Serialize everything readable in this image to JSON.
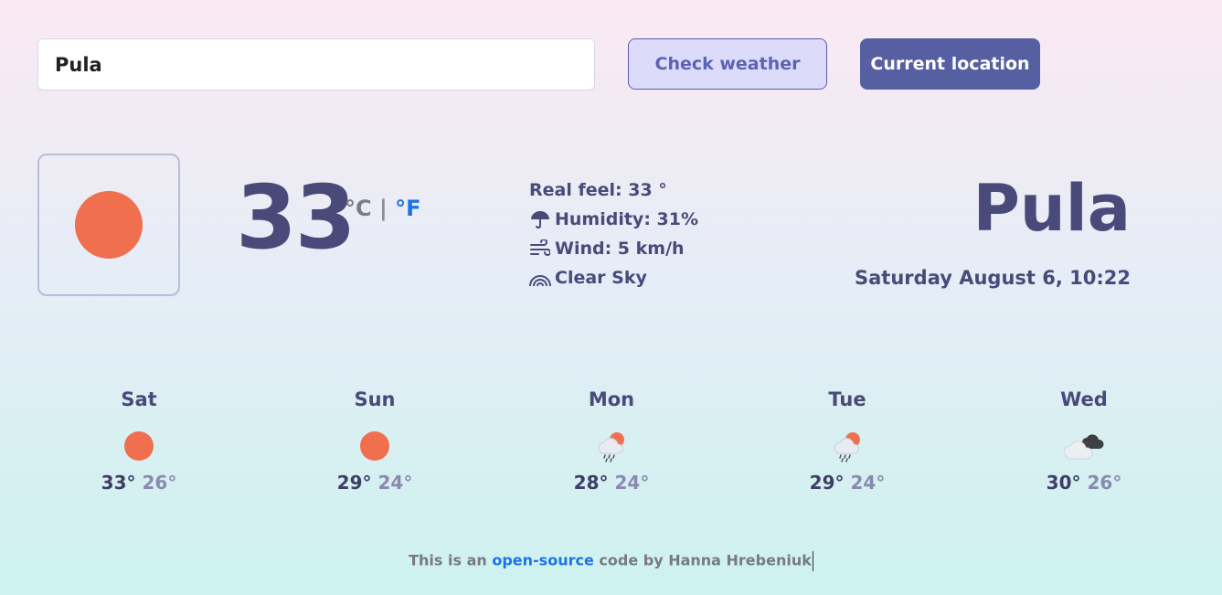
{
  "search": {
    "value": "Pula"
  },
  "buttons": {
    "check": "Check weather",
    "location": "Current location"
  },
  "current": {
    "icon": "sun-icon",
    "temperature": "33",
    "unit_c": "°C",
    "unit_sep": " | ",
    "unit_f": "°F",
    "real_feel": "Real feel: 33 °",
    "humidity": "Humidity: 31%",
    "wind": "Wind: 5 km/h",
    "description": "Clear Sky",
    "city": "Pula",
    "date": "Saturday August 6, 10:22"
  },
  "forecast": [
    {
      "day": "Sat",
      "icon": "sun-icon",
      "max": "33°",
      "min": "26°"
    },
    {
      "day": "Sun",
      "icon": "sun-icon",
      "max": "29°",
      "min": "24°"
    },
    {
      "day": "Mon",
      "icon": "rain-sun-icon",
      "max": "28°",
      "min": "24°"
    },
    {
      "day": "Tue",
      "icon": "rain-sun-icon",
      "max": "29°",
      "min": "24°"
    },
    {
      "day": "Wed",
      "icon": "cloudy-icon",
      "max": "30°",
      "min": "26°"
    }
  ],
  "footer": {
    "prefix": "This is an ",
    "link": "open-source",
    "suffix": " code by Hanna Hrebeniuk"
  },
  "colors": {
    "accent": "#575fa3",
    "sun": "#ef6f4e",
    "link": "#1a73e8",
    "text": "#4a4a7a"
  }
}
